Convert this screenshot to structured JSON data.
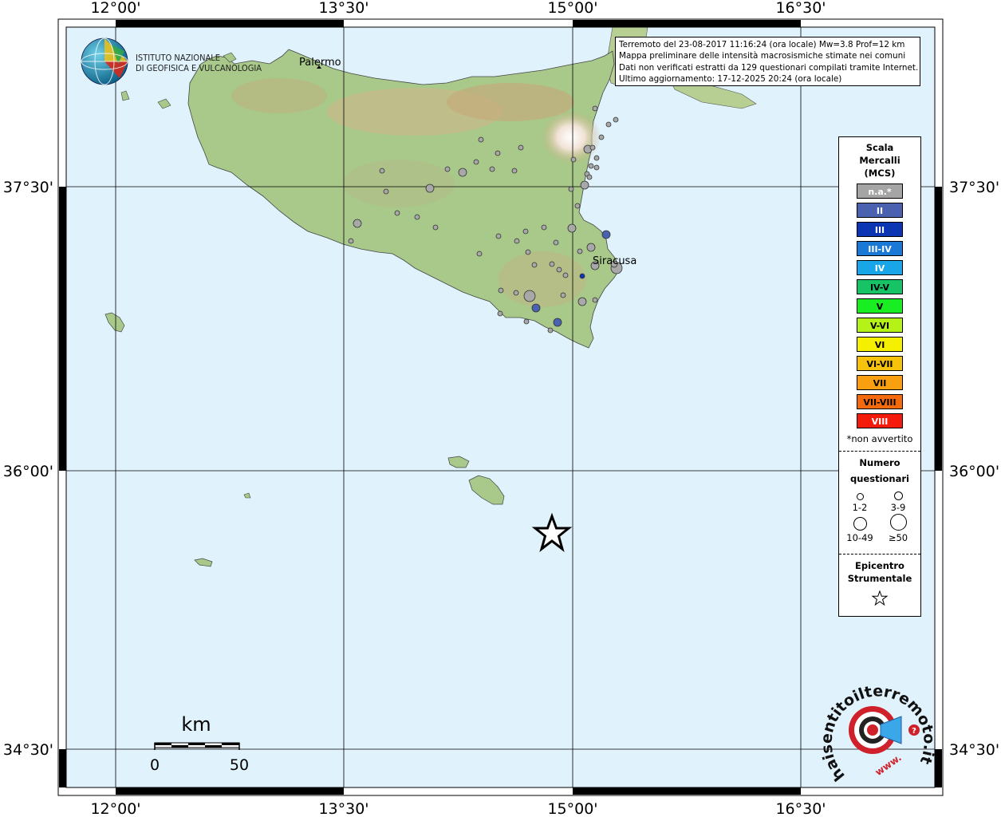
{
  "map": {
    "lon_labels": [
      "12°00'",
      "13°30'",
      "15°00'",
      "16°30'"
    ],
    "lat_labels": [
      "37°30'",
      "36°00'",
      "34°30'"
    ],
    "cities": [
      {
        "name": "Palermo"
      },
      {
        "name": "Siracusa"
      }
    ],
    "scalebar": {
      "unit": "km",
      "start": "0",
      "end": "50"
    },
    "colors": {
      "sea": "#e0f2fc",
      "land": "#a8c98a",
      "grid": "#000000"
    }
  },
  "logos": {
    "ingv": {
      "line1": "ISTITUTO NAZIONALE",
      "line2": "DI GEOFISICA E VULCANOLOGIA"
    },
    "hsit": {
      "text": "haisentitoilterremoto.it",
      "www": "www."
    }
  },
  "infobox": {
    "lines": [
      "Terremoto del 23-08-2017 11:16:24 (ora locale) Mw=3.8 Prof=12 km",
      "Mappa preliminare delle intensità macrosismiche stimate nei comuni",
      "Dati non verificati estratti da 129 questionari compilati tramite Internet.",
      "Ultimo aggiornamento: 17-12-2025 20:24 (ora locale)"
    ]
  },
  "legend": {
    "title1": "Scala",
    "title2": "Mercalli",
    "title3": "(MCS)",
    "classes": [
      {
        "label": "n.a.*",
        "color": "#a5a5a5",
        "text_color": "#ffffff"
      },
      {
        "label": "II",
        "color": "#4a62b0",
        "text_color": "#ffffff"
      },
      {
        "label": "III",
        "color": "#0a36b4",
        "text_color": "#ffffff"
      },
      {
        "label": "III-IV",
        "color": "#1a78d6",
        "text_color": "#ffffff"
      },
      {
        "label": "IV",
        "color": "#18a6e8",
        "text_color": "#ffffff"
      },
      {
        "label": "IV-V",
        "color": "#16c466",
        "text_color": "#000000"
      },
      {
        "label": "V",
        "color": "#18ee22",
        "text_color": "#000000"
      },
      {
        "label": "V-VI",
        "color": "#b4f218",
        "text_color": "#000000"
      },
      {
        "label": "VI",
        "color": "#f5f000",
        "text_color": "#000000"
      },
      {
        "label": "VI-VII",
        "color": "#f6c20c",
        "text_color": "#000000"
      },
      {
        "label": "VII",
        "color": "#f8a010",
        "text_color": "#000000"
      },
      {
        "label": "VII-VIII",
        "color": "#f46a0c",
        "text_color": "#000000"
      },
      {
        "label": "VIII",
        "color": "#f41a0c",
        "text_color": "#ffffff"
      }
    ],
    "note": "*non avvertito",
    "count_title1": "Numero",
    "count_title2": "questionari",
    "sizes": [
      "1-2",
      "3-9",
      "10-49",
      "≥50"
    ],
    "epicenter_title1": "Epicentro",
    "epicenter_title2": "Strumentale"
  }
}
